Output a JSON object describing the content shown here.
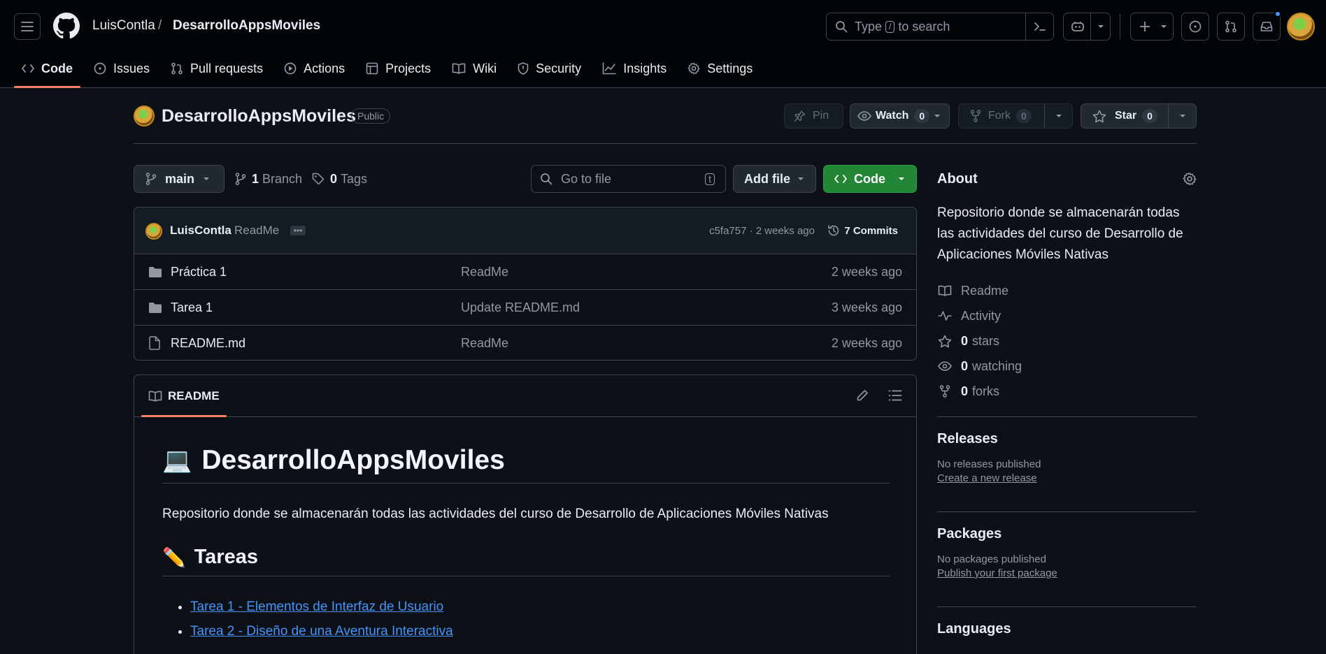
{
  "header": {
    "owner": "LuisContla",
    "separator": "/",
    "repo": "DesarrolloAppsMoviles",
    "search_prefix": "Type",
    "search_key": "/",
    "search_suffix": "to search",
    "tabs": [
      {
        "label": "Code"
      },
      {
        "label": "Issues"
      },
      {
        "label": "Pull requests"
      },
      {
        "label": "Actions"
      },
      {
        "label": "Projects"
      },
      {
        "label": "Wiki"
      },
      {
        "label": "Security"
      },
      {
        "label": "Insights"
      },
      {
        "label": "Settings"
      }
    ]
  },
  "repo": {
    "name": "DesarrolloAppsMoviles",
    "visibility": "Public",
    "pin_label": "Pin",
    "watch_label": "Watch",
    "watch_count": "0",
    "fork_label": "Fork",
    "fork_count": "0",
    "star_label": "Star",
    "star_count": "0"
  },
  "toolbar": {
    "branch": "main",
    "branch_count": "1",
    "branch_label": "Branch",
    "tag_count": "0",
    "tag_label": "Tags",
    "goto_placeholder": "Go to file",
    "goto_key": "t",
    "add_file": "Add file",
    "code": "Code"
  },
  "commit": {
    "author": "LuisContla",
    "message": "ReadMe",
    "meta": "c5fa757 · 2 weeks ago",
    "commits": "7 Commits"
  },
  "files": [
    {
      "name": "Práctica 1",
      "type": "folder",
      "message": "ReadMe",
      "age": "2 weeks ago"
    },
    {
      "name": "Tarea 1",
      "type": "folder",
      "message": "Update README.md",
      "age": "3 weeks ago"
    },
    {
      "name": "README.md",
      "type": "file",
      "message": "ReadMe",
      "age": "2 weeks ago"
    }
  ],
  "readme": {
    "tab": "README",
    "title_emoji": "💻",
    "title": "DesarrolloAppsMoviles",
    "description": "Repositorio donde se almacenarán todas las actividades del curso de Desarrollo de Aplicaciones Móviles Nativas",
    "section_emoji": "✏️",
    "section": "Tareas",
    "links": [
      "Tarea 1 - Elementos de Interfaz de Usuario",
      "Tarea 2 - Diseño de una Aventura Interactiva"
    ]
  },
  "about": {
    "heading": "About",
    "description": "Repositorio donde se almacenarán todas las actividades del curso de Desarrollo de Aplicaciones Móviles Nativas",
    "readme": "Readme",
    "activity": "Activity",
    "stars_count": "0",
    "stars_label": "stars",
    "watching_count": "0",
    "watching_label": "watching",
    "forks_count": "0",
    "forks_label": "forks"
  },
  "releases": {
    "heading": "Releases",
    "none": "No releases published",
    "link": "Create a new release"
  },
  "packages": {
    "heading": "Packages",
    "none": "No packages published",
    "link": "Publish your first package"
  },
  "languages": {
    "heading": "Languages"
  },
  "colors": {
    "accent_tab": "#f78166",
    "code_button": "#238636",
    "link": "#4493f8",
    "notification_dot": "#4493f8"
  }
}
